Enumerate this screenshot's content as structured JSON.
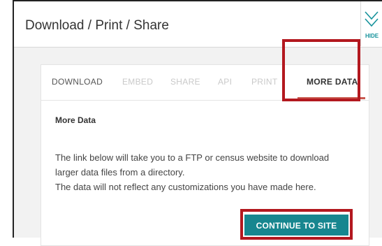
{
  "header": {
    "title": "Download / Print / Share",
    "hide_label": "HIDE"
  },
  "tabs": [
    {
      "label": "DOWNLOAD"
    },
    {
      "label": "EMBED"
    },
    {
      "label": "SHARE"
    },
    {
      "label": "API"
    },
    {
      "label": "PRINT"
    },
    {
      "label": "MORE DATA"
    }
  ],
  "content": {
    "section_title": "More Data",
    "description_lines": [
      "The link below will take you to a FTP or census website to download",
      "larger data files from a directory.",
      "The data will not reflect any customizations you have made here."
    ],
    "button_label": "CONTINUE TO SITE"
  },
  "colors": {
    "accent": "#17868f",
    "highlight": "#b3181f",
    "tab_underline": "#c9594f"
  },
  "icons": {
    "hide": "double-chevron-down-icon"
  }
}
